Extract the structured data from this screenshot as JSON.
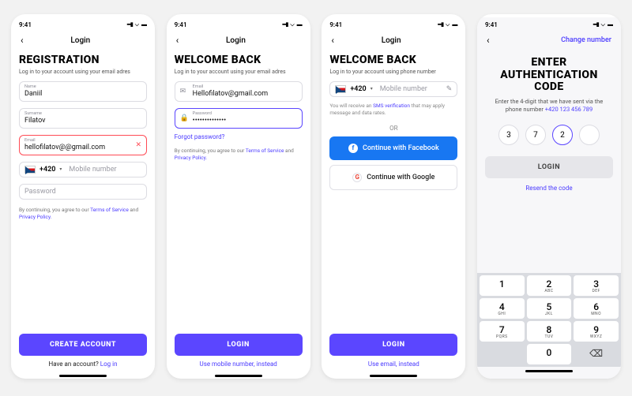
{
  "accent": "#5b46ff",
  "status_time": "9:41",
  "screens": [
    {
      "nav_title": "Login",
      "heading": "REGISTRATION",
      "subtitle": "Log in to your account using your email adres",
      "fields": {
        "name": {
          "label": "Name",
          "value": "Daniil"
        },
        "surname": {
          "label": "Surname",
          "value": "Filatov"
        },
        "email": {
          "label": "Email",
          "value": "hellofilatov@@gmail.com",
          "error": true
        },
        "phone": {
          "dial": "+420",
          "placeholder": "Mobile number"
        },
        "password": {
          "placeholder": "Password"
        }
      },
      "legal": {
        "prefix": "By continuing, you agree to our ",
        "tos": "Terms of Service",
        "mid": " and ",
        "pp": "Privacy Policy."
      },
      "primary": "CREATE ACCOUNT",
      "below": {
        "text": "Have an account? ",
        "link": "Log in"
      }
    },
    {
      "nav_title": "Login",
      "heading": "WELCOME BACK",
      "subtitle": "Log in to your account using your email adres",
      "fields": {
        "email": {
          "label": "Email",
          "value": "Hellofilatov@gmail.com"
        },
        "password": {
          "label": "Password",
          "value": "••••••••••••••",
          "focused": true
        }
      },
      "forgot": "Forgot password?",
      "legal": {
        "prefix": "By continuing, you agree to our ",
        "tos": "Terms of Service",
        "mid": " and ",
        "pp": "Privacy Policy."
      },
      "primary": "LOGIN",
      "alt_link": "Use mobile number, instead"
    },
    {
      "nav_title": "Login",
      "heading": "WELCOME BACK",
      "subtitle": "Log in to your account using phone number",
      "fields": {
        "phone": {
          "dial": "+420",
          "placeholder": "Mobile number"
        }
      },
      "sms_note": {
        "prefix": "You will receive an ",
        "link": "SMS verification",
        "suffix": " that may apply message and data rates."
      },
      "or": "OR",
      "social": {
        "facebook": "Continue with Facebook",
        "google": "Continue with Google"
      },
      "primary": "LOGIN",
      "alt_link": "Use email, instead"
    },
    {
      "nav_action": "Change number",
      "heading_l1": "ENTER",
      "heading_l2": "AUTHENTICATION",
      "heading_l3": "CODE",
      "help": {
        "prefix": "Enter the 4-digit that we have sent via the phone number ",
        "number": "+420 123 456 789"
      },
      "digits": [
        "3",
        "7",
        "2",
        ""
      ],
      "active_index": 2,
      "primary": "LOGIN",
      "resend": "Resend the code",
      "keypad": [
        {
          "n": "1",
          "l": ""
        },
        {
          "n": "2",
          "l": "ABC"
        },
        {
          "n": "3",
          "l": "DEF"
        },
        {
          "n": "4",
          "l": "GHI"
        },
        {
          "n": "5",
          "l": "JKL"
        },
        {
          "n": "6",
          "l": "MNO"
        },
        {
          "n": "7",
          "l": "PQRS"
        },
        {
          "n": "8",
          "l": "TUV"
        },
        {
          "n": "9",
          "l": "WXYZ"
        },
        {
          "blank": true
        },
        {
          "n": "0",
          "l": ""
        },
        {
          "del": true
        }
      ]
    }
  ]
}
